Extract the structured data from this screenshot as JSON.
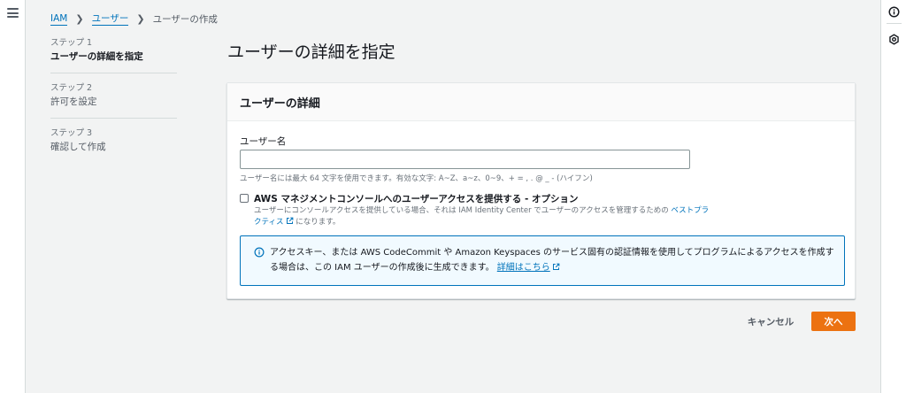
{
  "breadcrumb": {
    "root": "IAM",
    "parent": "ユーザー",
    "current": "ユーザーの作成"
  },
  "steps": [
    {
      "num": "ステップ 1",
      "name": "ユーザーの詳細を指定"
    },
    {
      "num": "ステップ 2",
      "name": "許可を設定"
    },
    {
      "num": "ステップ 3",
      "name": "確認して作成"
    }
  ],
  "page_title": "ユーザーの詳細を指定",
  "panel": {
    "header": "ユーザーの詳細",
    "username_label": "ユーザー名",
    "username_value": "",
    "username_hint": "ユーザー名には最大 64 文字を使用できます。有効な文字: A~Z、a~z、0~9、+ = , . @ _ - (ハイフン)",
    "console_checkbox_label": "AWS マネジメントコンソールへのユーザーアクセスを提供する - オプション",
    "console_checkbox_checked": false,
    "console_desc_prefix": "ユーザーにコンソールアクセスを提供している場合、それは IAM Identity Center でユーザーのアクセスを管理するための",
    "console_desc_link": "ベストプラクティス",
    "console_desc_suffix": "になります。",
    "info_text": "アクセスキー、または AWS CodeCommit や Amazon Keyspaces のサービス固有の認証情報を使用してプログラムによるアクセスを作成する場合は、この IAM ユーザーの作成後に生成できます。",
    "info_link": "詳細はこちら"
  },
  "buttons": {
    "cancel": "キャンセル",
    "next": "次へ"
  },
  "colors": {
    "accent": "#ec7211",
    "link": "#0073bb",
    "info_bg": "#f1faff"
  },
  "icons": {
    "menu": "menu-icon",
    "info": "info-icon",
    "settings": "gear-icon",
    "external": "external-link-icon"
  }
}
